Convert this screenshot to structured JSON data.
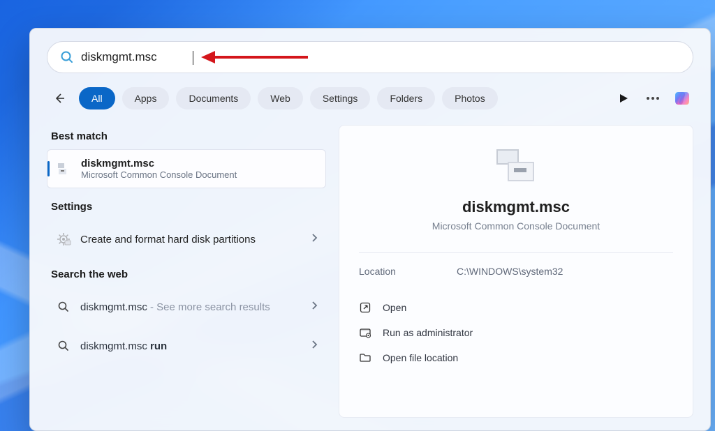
{
  "search": {
    "value": "diskmgmt.msc"
  },
  "tabs": [
    "All",
    "Apps",
    "Documents",
    "Web",
    "Settings",
    "Folders",
    "Photos"
  ],
  "left": {
    "best_match_label": "Best match",
    "best_match": {
      "title": "diskmgmt.msc",
      "subtitle": "Microsoft Common Console Document"
    },
    "settings_label": "Settings",
    "settings_item": {
      "title": "Create and format hard disk partitions"
    },
    "search_web_label": "Search the web",
    "web1": {
      "title": "diskmgmt.msc",
      "suffix": " - See more search results"
    },
    "web2": {
      "title": "diskmgmt.msc",
      "bold": " run"
    }
  },
  "preview": {
    "title": "diskmgmt.msc",
    "type": "Microsoft Common Console Document",
    "location_label": "Location",
    "location_value": "C:\\WINDOWS\\system32",
    "open": "Open",
    "run_admin": "Run as administrator",
    "open_loc": "Open file location"
  }
}
